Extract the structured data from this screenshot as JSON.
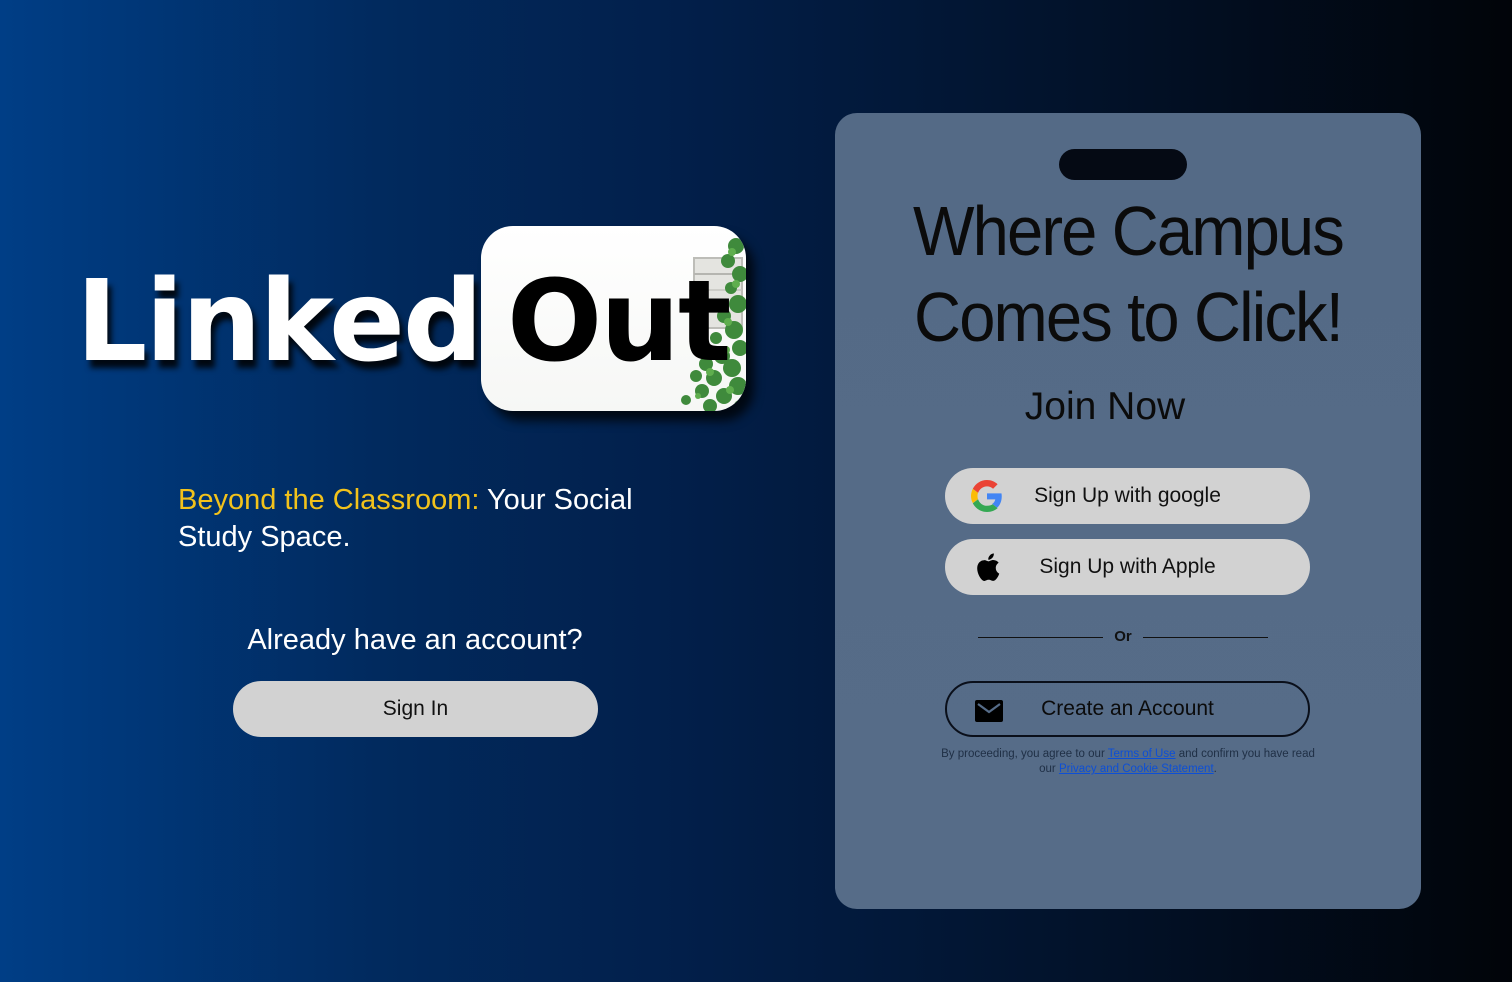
{
  "logo": {
    "part1": "Linked",
    "part2": "Out"
  },
  "left": {
    "tagline_accent": "Beyond the Classroom:",
    "tagline_rest": " Your Social Study Space.",
    "already_text": "Already have an account?",
    "signin_label": "Sign In"
  },
  "card": {
    "headline": "Where Campus Comes to Click!",
    "join_title": "Join Now",
    "google_label": "Sign Up with google",
    "apple_label": "Sign Up with Apple",
    "or_label": "Or",
    "create_label": "Create an Account",
    "legal": {
      "prefix": "By proceeding, you agree to our ",
      "terms_link": "Terms of Use",
      "middle": " and confirm you have read our ",
      "privacy_link": "Privacy and Cookie Statement",
      "suffix": "."
    }
  },
  "icons": {
    "google": "google-icon",
    "apple": "apple-icon",
    "email": "mail-icon",
    "ivy": "ivy-decoration"
  },
  "colors": {
    "accent": "#f2c21b",
    "card_bg": "#556b87",
    "pill_bg": "#d2d2d2",
    "link": "#0d4fd6"
  }
}
